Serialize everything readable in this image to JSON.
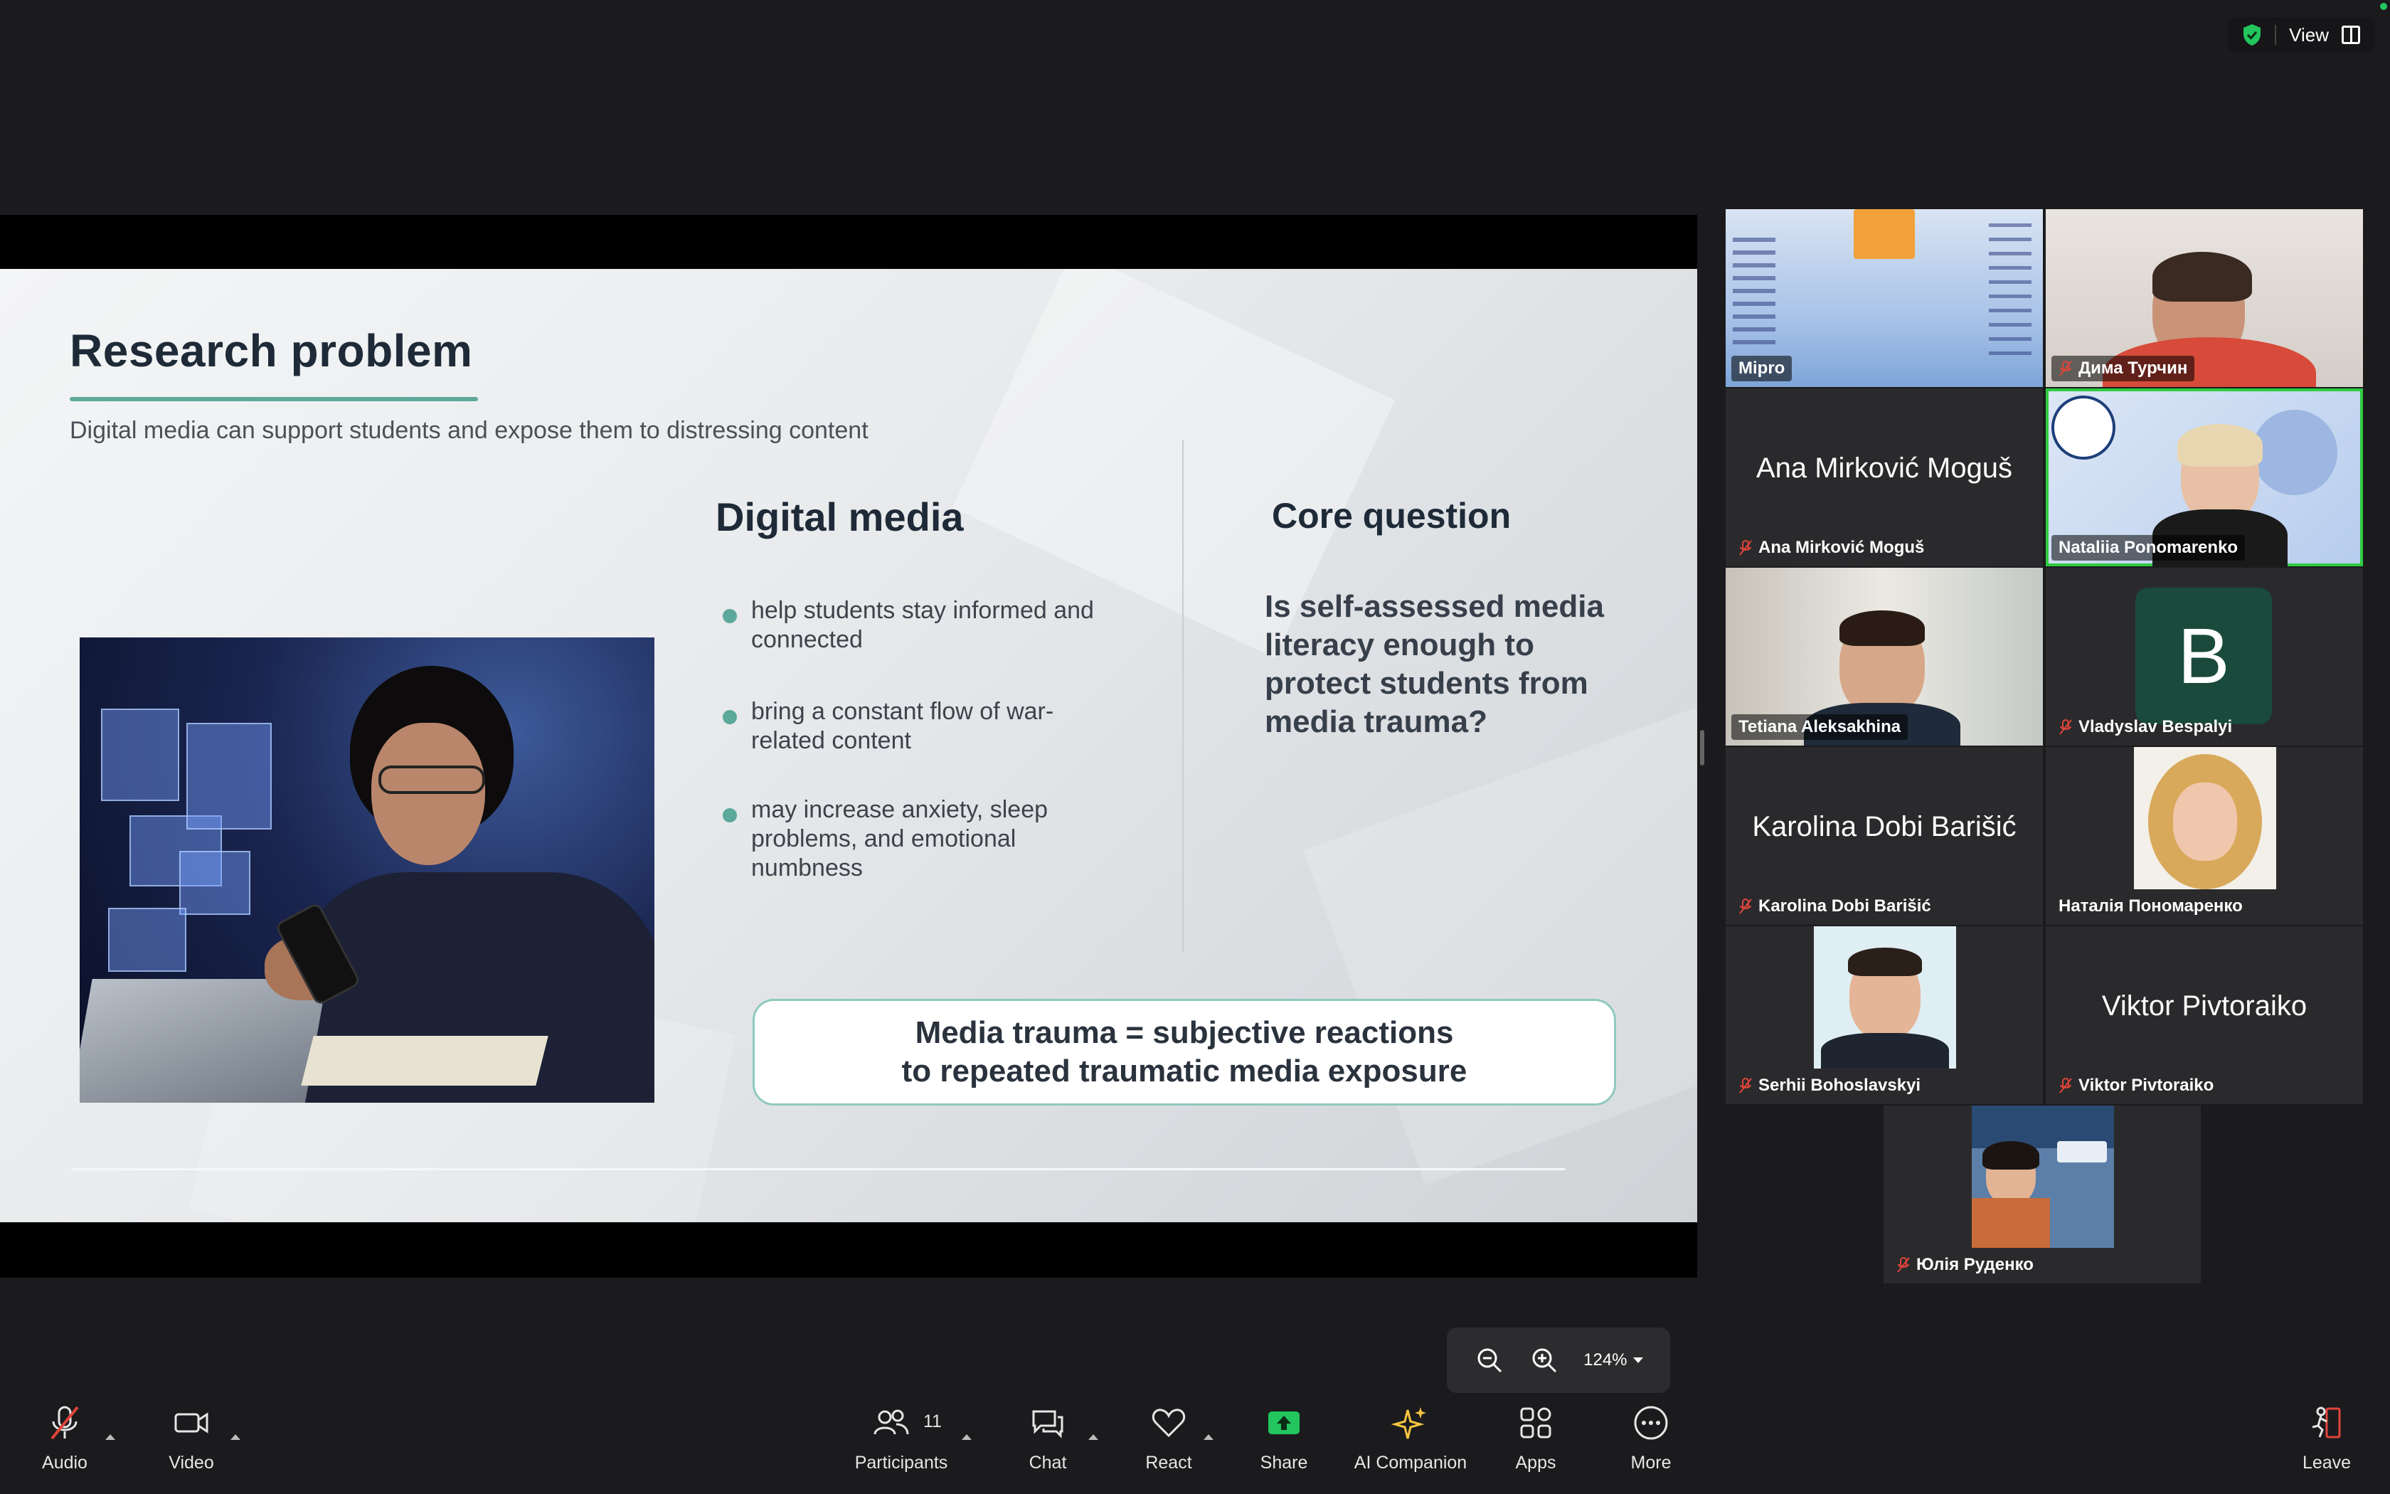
{
  "top_right": {
    "view_label": "View"
  },
  "slide": {
    "title": "Research problem",
    "subtitle": "Digital media can support students and expose them to distressing content",
    "col1_heading": "Digital media",
    "bullets": [
      "help students stay informed and connected",
      "bring a constant flow of war-related content",
      "may increase anxiety, sleep problems, and emotional numbness"
    ],
    "col2_heading": "Core question",
    "question": "Is self-assessed media literacy enough to protect students from media trauma?",
    "callout_line1": "Media trauma = subjective reactions",
    "callout_line2": "to repeated traumatic media exposure"
  },
  "gallery": {
    "tiles": [
      {
        "name": "Mipro",
        "muted": false,
        "kind": "poster"
      },
      {
        "name": "Дима Турчин",
        "muted": true,
        "kind": "video"
      },
      {
        "name": "Ana Mirković Moguš",
        "muted": true,
        "kind": "name"
      },
      {
        "name": "Nataliia Ponomarenko",
        "muted": false,
        "kind": "video",
        "active": true
      },
      {
        "name": "Tetiana Aleksakhina",
        "muted": false,
        "kind": "video"
      },
      {
        "name": "Vladyslav Bespalyi",
        "muted": true,
        "kind": "avatar",
        "initial": "B"
      },
      {
        "name": "Karolina Dobi Barišić",
        "muted": true,
        "kind": "name"
      },
      {
        "name": "Наталія Пономаренко",
        "muted": false,
        "kind": "photo"
      },
      {
        "name": "Serhii Bohoslavskyi",
        "muted": true,
        "kind": "photo"
      },
      {
        "name": "Viktor Pivtoraiko",
        "muted": true,
        "kind": "name"
      },
      {
        "name": "Юлія Руденко",
        "muted": true,
        "kind": "photo"
      }
    ]
  },
  "zoom": {
    "value": "124%"
  },
  "toolbar": {
    "audio": "Audio",
    "video": "Video",
    "participants": "Participants",
    "participants_count": "11",
    "chat": "Chat",
    "react": "React",
    "share": "Share",
    "ai_companion": "AI Companion",
    "apps": "Apps",
    "more": "More",
    "leave": "Leave"
  },
  "colors": {
    "accent_green": "#2ecc40",
    "share_green": "#22c55e",
    "muted_red": "#e0453a",
    "slide_teal": "#5fa89a",
    "ai_gold": "#f5c542"
  }
}
